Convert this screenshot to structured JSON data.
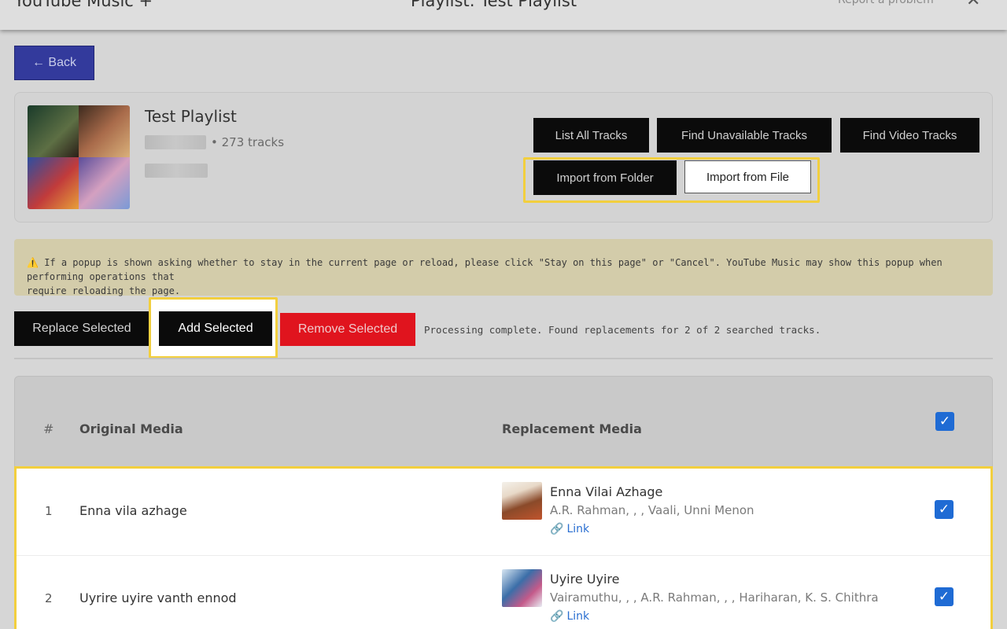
{
  "topbar": {
    "app_title": "YouTube Music +",
    "playlist_title": "Playlist: Test Playlist",
    "report": "Report a problem",
    "close": "✕"
  },
  "back_label": "← Back",
  "playlist": {
    "name": "Test Playlist",
    "tracks": "• 273 tracks"
  },
  "buttons": {
    "list_all": "List All Tracks",
    "find_unavailable": "Find Unavailable Tracks",
    "find_video": "Find Video Tracks",
    "import_folder": "Import from Folder",
    "import_file": "Import from File",
    "replace_selected": "Replace Selected",
    "add_selected": "Add Selected",
    "remove_selected": "Remove Selected"
  },
  "warning": {
    "icon": "⚠️",
    "line1": "If a popup is shown asking whether to stay in the current page or reload, please click \"Stay on this page\" or \"Cancel\". YouTube Music may show this popup when performing operations that",
    "line2": "require reloading the page."
  },
  "status": "Processing complete. Found replacements for 2 of 2 searched tracks.",
  "table": {
    "headers": {
      "num": "#",
      "original": "Original Media",
      "replacement": "Replacement Media"
    },
    "rows": [
      {
        "num": "1",
        "original": "Enna vila azhage",
        "title": "Enna Vilai Azhage",
        "artists": "A.R. Rahman, , , Vaali, Unni Menon",
        "link": "Link"
      },
      {
        "num": "2",
        "original": "Uyrire uyire vanth ennod",
        "title": "Uyire Uyire",
        "artists": "Vairamuthu, , , A.R. Rahman, , , Hariharan, K. S. Chithra",
        "link": "Link"
      }
    ]
  },
  "colors": {
    "accent_blue": "#1f6bd4",
    "highlight": "#f2cf3e",
    "danger": "#e0141e",
    "back": "#333a9c"
  }
}
